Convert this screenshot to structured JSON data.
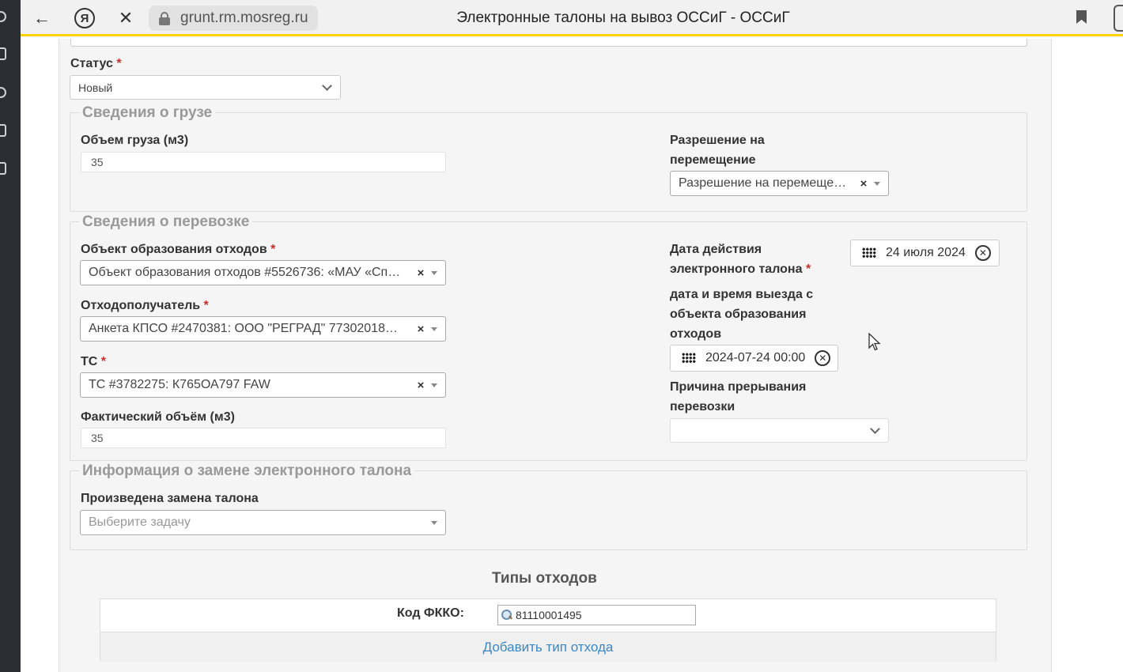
{
  "browser": {
    "url": "grunt.rm.mosreg.ru",
    "page_title": "Электронные талоны на вывоз ОССиГ - ОССиГ",
    "ya_letter": "Я"
  },
  "form": {
    "status": {
      "label": "Статус",
      "required_mark": "*",
      "value": "Новый"
    },
    "cargo": {
      "legend": "Сведения о грузе",
      "volume_label": "Объем груза (м3)",
      "volume_value": "35",
      "permit_label_line1": "Разрешение на",
      "permit_label_line2": "перемещение",
      "permit_value": "Разрешение на перемеще…"
    },
    "transport": {
      "legend": "Сведения о перевозке",
      "origin_label": "Объект образования отходов",
      "origin_value": "Объект образования отходов #5526736: «МАУ «Сп…",
      "recipient_label": "Отходополучатель",
      "recipient_value": "Анкета КПСО #2470381: ООО \"РЕГРАД\" 77302018…",
      "vehicle_label": "ТС",
      "vehicle_value": "ТС #3782275: К765ОА797 FAW",
      "actual_volume_label": "Фактический объём (м3)",
      "actual_volume_value": "35",
      "validity_label_line1": "Дата действия",
      "validity_label_line2": "электронного талона",
      "validity_value": "24 июля 2024",
      "departure_label_line1": "дата и время выезда с",
      "departure_label_line2": "объекта образования",
      "departure_label_line3": "отходов",
      "departure_value": "2024-07-24 00:00",
      "interrupt_label_line1": "Причина прерывания",
      "interrupt_label_line2": "перевозки",
      "interrupt_value": ""
    },
    "replacement": {
      "legend": "Информация о замене электронного талона",
      "done_label": "Произведена замена талона",
      "done_placeholder": "Выберите задачу"
    },
    "required_mark": "*",
    "clear_symbol": "×",
    "circle_clear_symbol": "✕"
  },
  "waste_types": {
    "title": "Типы отходов",
    "fkko_label": "Код ФККО:",
    "fkko_value": "81110001495",
    "add_link": "Добавить тип отхода"
  },
  "icons": [
    "back-arrow-icon",
    "yandex-icon",
    "close-icon",
    "lock-icon",
    "bookmark-icon",
    "calendar-icon",
    "clear-circle-icon",
    "magnifier-icon",
    "mouse-cursor-icon"
  ]
}
